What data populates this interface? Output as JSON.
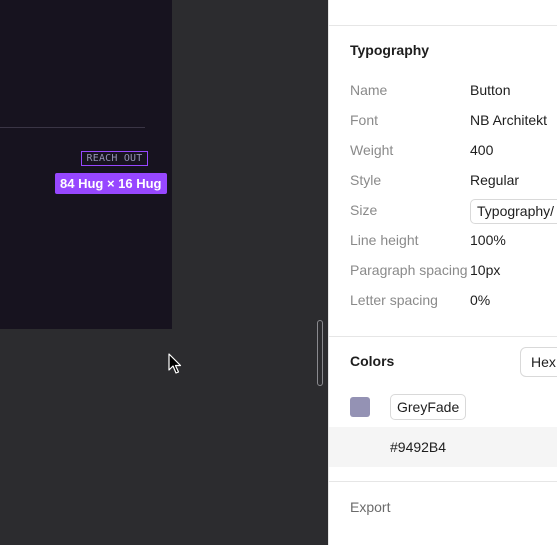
{
  "canvas": {
    "element_label": "REACH OUT",
    "size_badge": "84 Hug × 16 Hug"
  },
  "typography": {
    "title": "Typography",
    "name_label": "Name",
    "name_value": "Button",
    "font_label": "Font",
    "font_value": "NB Architekt",
    "weight_label": "Weight",
    "weight_value": "400",
    "style_label": "Style",
    "style_value": "Regular",
    "size_label": "Size",
    "size_value": "Typography/",
    "line_height_label": "Line height",
    "line_height_value": "100%",
    "paragraph_label": "Paragraph spacing",
    "paragraph_value": "10px",
    "letter_label": "Letter spacing",
    "letter_value": "0%"
  },
  "colors": {
    "title": "Colors",
    "format": "Hex",
    "style_name": "GreyFade",
    "hex": "#9492B4",
    "swatch_color": "#9492B4"
  },
  "export": {
    "title": "Export"
  },
  "icons": {
    "cursor": "mouse-pointer-icon"
  }
}
